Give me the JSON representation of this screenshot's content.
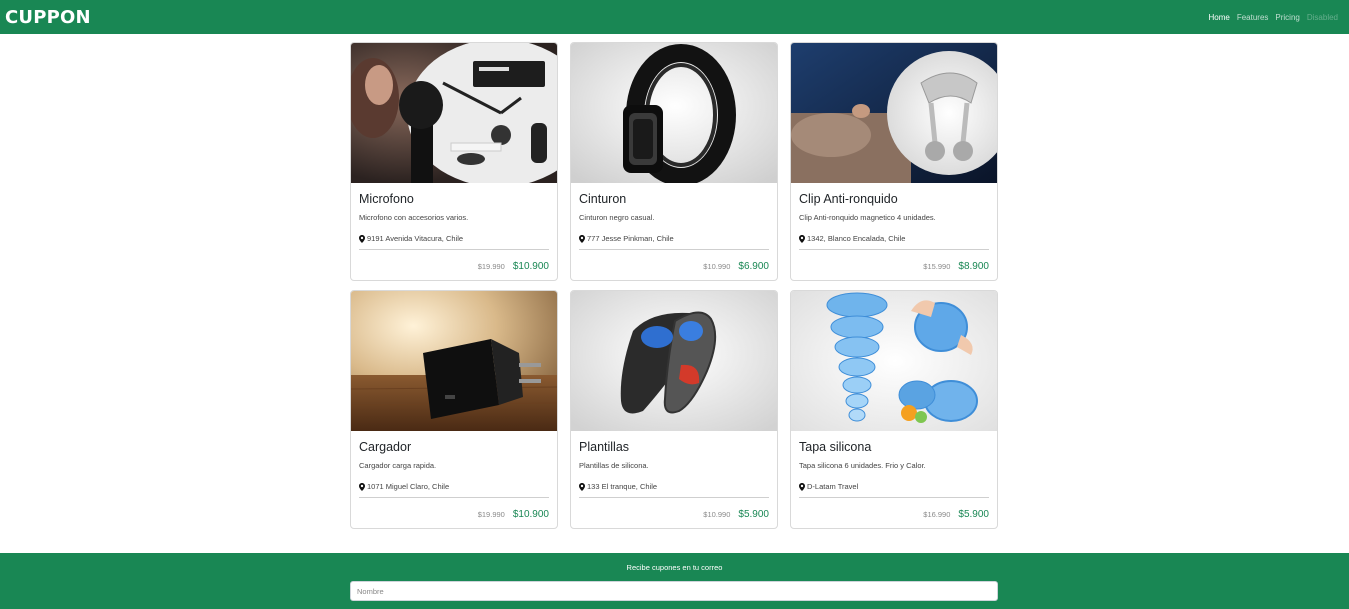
{
  "nav": {
    "brand": "CUPPON",
    "links": [
      "Home",
      "Features",
      "Pricing",
      "Disabled"
    ]
  },
  "products": [
    {
      "title": "Microfono",
      "desc": "Microfono con accesorios varios.",
      "location": "9191 Avenida Vitacura, Chile",
      "old_price": "$19.990",
      "new_price": "$10.900",
      "image": "microphone-kit"
    },
    {
      "title": "Cinturon",
      "desc": "Cinturon negro casual.",
      "location": "777 Jesse Pinkman, Chile",
      "old_price": "$10.990",
      "new_price": "$6.900",
      "image": "black-belt"
    },
    {
      "title": "Clip Anti-ronquido",
      "desc": "Clip Anti-ronquido magnetico 4 unidades.",
      "location": "1342, Blanco Encalada, Chile",
      "old_price": "$15.990",
      "new_price": "$8.900",
      "image": "nose-clip"
    },
    {
      "title": "Cargador",
      "desc": "Cargador carga rapida.",
      "location": "1071 Miguel Claro, Chile",
      "old_price": "$19.990",
      "new_price": "$10.900",
      "image": "wall-charger"
    },
    {
      "title": "Plantillas",
      "desc": "Plantillas de silicona.",
      "location": "133 El tranque, Chile",
      "old_price": "$10.990",
      "new_price": "$5.900",
      "image": "insoles"
    },
    {
      "title": "Tapa silicona",
      "desc": "Tapa silicona 6 unidades. Frio y Calor.",
      "location": "D-Latam Travel",
      "old_price": "$16.990",
      "new_price": "$5.900",
      "image": "silicone-lids"
    }
  ],
  "footer": {
    "title": "Recibe cupones en tu correo",
    "name_placeholder": "Nombre"
  },
  "colors": {
    "brand_green": "#198754"
  }
}
